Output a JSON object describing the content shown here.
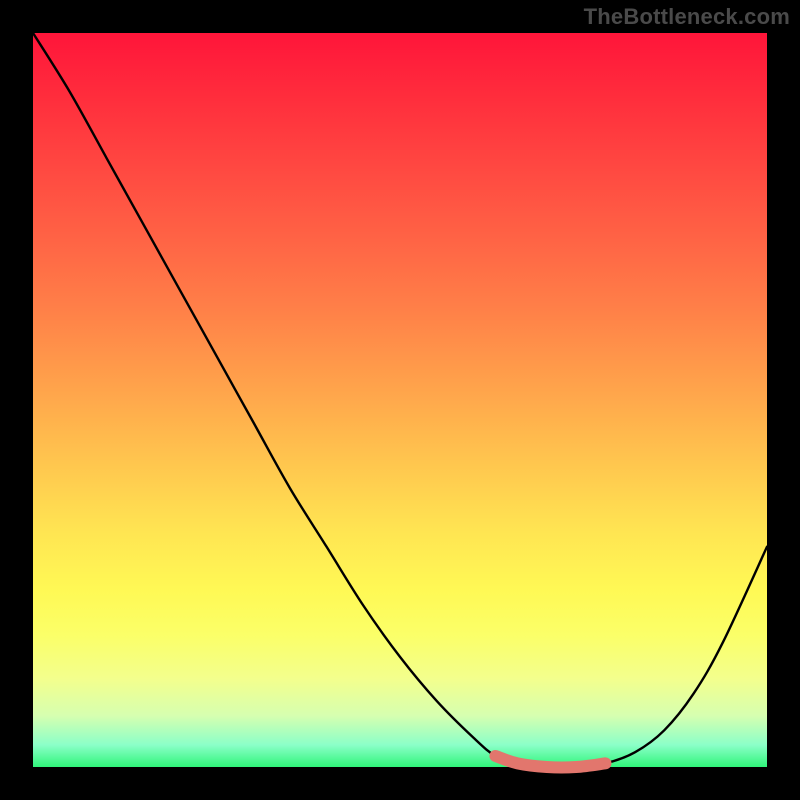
{
  "watermark": "TheBottleneck.com",
  "chart_data": {
    "type": "line",
    "title": "",
    "xlabel": "",
    "ylabel": "",
    "x": [
      0.0,
      0.05,
      0.1,
      0.15,
      0.2,
      0.25,
      0.3,
      0.35,
      0.4,
      0.45,
      0.5,
      0.55,
      0.6,
      0.63,
      0.66,
      0.7,
      0.74,
      0.78,
      0.82,
      0.86,
      0.9,
      0.94,
      1.0
    ],
    "values": [
      1.0,
      0.92,
      0.83,
      0.74,
      0.65,
      0.56,
      0.47,
      0.38,
      0.3,
      0.22,
      0.15,
      0.09,
      0.04,
      0.015,
      0.005,
      0.0,
      0.0,
      0.005,
      0.02,
      0.05,
      0.1,
      0.17,
      0.3
    ],
    "ylim": [
      0,
      1
    ],
    "xlim": [
      0,
      1
    ],
    "valley_highlight": {
      "x_start": 0.63,
      "x_end": 0.8,
      "color": "#e2766d",
      "stroke_width": 12
    },
    "background_gradient": {
      "top": "#ff153a",
      "bottom": "#30f57a"
    },
    "frame_color": "#000000",
    "curve_color": "#000000"
  }
}
